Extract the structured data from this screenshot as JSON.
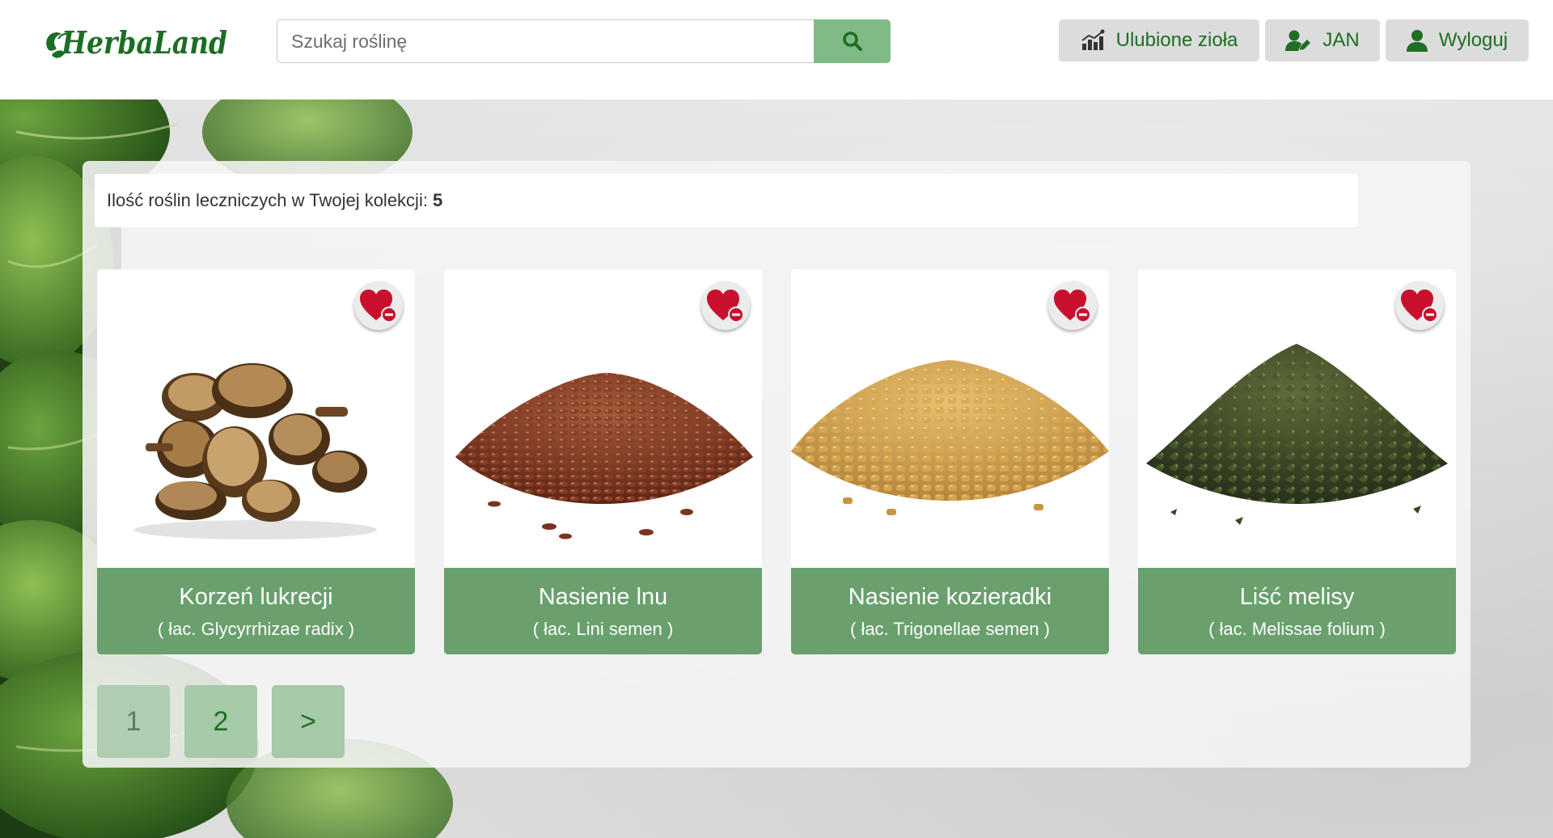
{
  "header": {
    "logo_text": "HerbaLand",
    "search": {
      "placeholder": "Szukaj roślinę",
      "value": "",
      "button_icon": "search-icon"
    },
    "nav": [
      {
        "label": "Ulubione zioła",
        "icon": "herbs-chart-icon"
      },
      {
        "label": "JAN",
        "icon": "user-edit-icon"
      },
      {
        "label": "Wyloguj",
        "icon": "user-icon"
      }
    ]
  },
  "collection": {
    "label": "Ilość roślin leczniczych w Twojej kolekcji:",
    "count": "5"
  },
  "cards": [
    {
      "name": "Korzeń lukrecji",
      "latin": "( łac. Glycyrrhizae radix )",
      "image": "licorice-root-pieces",
      "action_icon": "heart-remove-icon"
    },
    {
      "name": "Nasienie lnu",
      "latin": "( łac. Lini semen )",
      "image": "flax-seeds-pile",
      "action_icon": "heart-remove-icon"
    },
    {
      "name": "Nasienie kozieradki",
      "latin": "( łac. Trigonellae semen )",
      "image": "fenugreek-seeds-pile",
      "action_icon": "heart-remove-icon"
    },
    {
      "name": "Liść melisy",
      "latin": "( łac. Melissae folium )",
      "image": "lemon-balm-leaves-pile",
      "action_icon": "heart-remove-icon"
    }
  ],
  "pagination": {
    "pages": [
      "1",
      "2"
    ],
    "next": ">",
    "current": "1"
  },
  "colors": {
    "brand_green": "#1e6e24",
    "caption_green": "#69a06d",
    "search_button": "#7fba87",
    "heart_red": "#c8102e"
  }
}
